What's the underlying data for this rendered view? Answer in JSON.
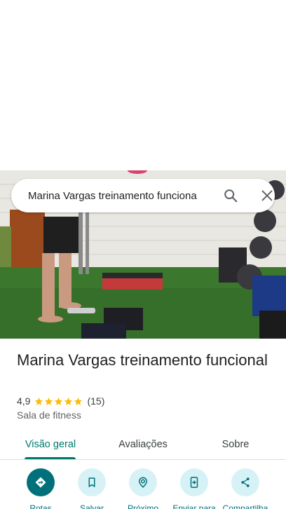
{
  "search": {
    "query": "Marina Vargas treinamento funciona"
  },
  "hero_image": {
    "alt": "Foto do estúdio"
  },
  "place": {
    "name": "Marina Vargas treinamento funcional",
    "rating": "4,9",
    "stars": 5,
    "reviews_count": "(15)",
    "category": "Sala de fitness"
  },
  "tabs": [
    {
      "label": "Visão geral",
      "active": true
    },
    {
      "label": "Avaliações",
      "active": false
    },
    {
      "label": "Sobre",
      "active": false
    }
  ],
  "actions": [
    {
      "label": "Rotas",
      "icon": "directions-icon"
    },
    {
      "label": "Salvar",
      "icon": "bookmark-icon"
    },
    {
      "label": "Próximo",
      "icon": "nearby-icon"
    },
    {
      "label": "Enviar para",
      "icon": "send-to-phone-icon"
    },
    {
      "label": "Compartilha",
      "icon": "share-icon"
    }
  ],
  "colors": {
    "accent": "#00796b",
    "star": "#fbbc04",
    "action_bg": "#d7f2f6",
    "primary_action": "#00717a"
  }
}
